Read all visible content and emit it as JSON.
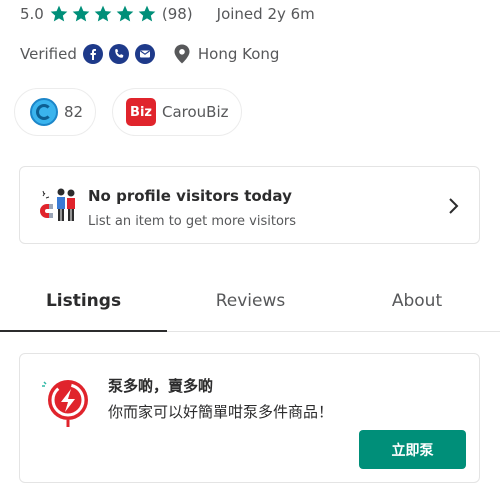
{
  "profile": {
    "rating": "5.0",
    "star_count": 5,
    "review_count": "(98)",
    "joined": "Joined 2y 6m",
    "verified_label": "Verified",
    "verified_icons": [
      "facebook-icon",
      "phone-icon",
      "email-icon"
    ],
    "location": "Hong Kong"
  },
  "badges": {
    "coins": "82",
    "carousell_biz": "CarouBiz",
    "biz_icon_text": "Biz"
  },
  "visitors": {
    "title": "No profile visitors today",
    "subtitle": "List an item to get more visitors"
  },
  "tabs": {
    "listings": "Listings",
    "reviews": "Reviews",
    "about": "About",
    "active": "listings"
  },
  "promo": {
    "title": "泵多啲，賣多啲",
    "text": "你而家可以好簡單咁泵多件商品！",
    "button": "立即泵"
  },
  "colors": {
    "star": "#008f79",
    "verified_icon_bg": "#1e3a8a",
    "button": "#008f79",
    "biz_red": "#e0242c"
  }
}
